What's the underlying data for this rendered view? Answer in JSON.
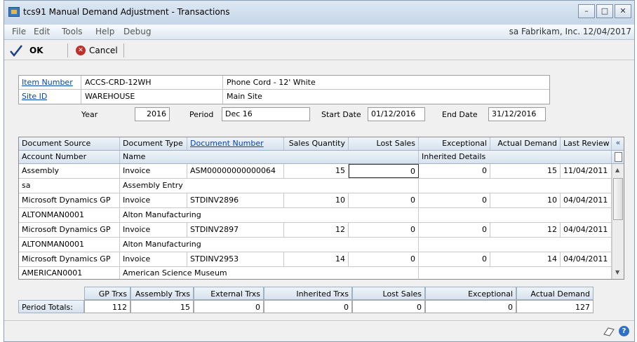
{
  "window": {
    "title": "tcs91 Manual Demand Adjustment - Transactions",
    "minimize": "–",
    "maximize": "□",
    "close": "✕"
  },
  "menu": {
    "items": [
      "File",
      "Edit",
      "Tools",
      "Help",
      "Debug"
    ],
    "company": "sa  Fabrikam, Inc. 12/04/2017"
  },
  "toolbar": {
    "ok_label": "OK",
    "cancel_label": "Cancel"
  },
  "header": {
    "item_number_label": "Item Number",
    "item_number": "ACCS-CRD-12WH",
    "item_description": "Phone Cord - 12' White",
    "site_id_label": "Site ID",
    "site_id": "WAREHOUSE",
    "site_description": "Main Site",
    "year_label": "Year",
    "year": "2016",
    "period_label": "Period",
    "period": "Dec 16",
    "start_date_label": "Start Date",
    "start_date": "01/12/2016",
    "end_date_label": "End Date",
    "end_date": "31/12/2016"
  },
  "grid": {
    "headers1": [
      "Document Source",
      "Document Type",
      "Document Number",
      "Sales Quantity",
      "Lost Sales",
      "Exceptional",
      "Actual Demand",
      "Last Review"
    ],
    "headers2": [
      "Account Number",
      "Name",
      "Inherited Details"
    ],
    "rows": [
      {
        "source": "Assembly",
        "type": "Invoice",
        "number": "ASM00000000000064",
        "sales_qty": "15",
        "lost_sales": "0",
        "exceptional": "0",
        "actual_demand": "15",
        "last_review": "11/04/2011",
        "account": "sa",
        "name": "Assembly Entry",
        "inherited": ""
      },
      {
        "source": "Microsoft Dynamics GP",
        "type": "Invoice",
        "number": "STDINV2896",
        "sales_qty": "10",
        "lost_sales": "0",
        "exceptional": "0",
        "actual_demand": "10",
        "last_review": "04/04/2011",
        "account": "ALTONMAN0001",
        "name": "Alton Manufacturing",
        "inherited": ""
      },
      {
        "source": "Microsoft Dynamics GP",
        "type": "Invoice",
        "number": "STDINV2897",
        "sales_qty": "12",
        "lost_sales": "0",
        "exceptional": "0",
        "actual_demand": "12",
        "last_review": "04/04/2011",
        "account": "ALTONMAN0001",
        "name": "Alton Manufacturing",
        "inherited": ""
      },
      {
        "source": "Microsoft Dynamics GP",
        "type": "Invoice",
        "number": "STDINV2953",
        "sales_qty": "14",
        "lost_sales": "0",
        "exceptional": "0",
        "actual_demand": "14",
        "last_review": "04/04/2011",
        "account": "AMERICAN0001",
        "name": "American Science Museum",
        "inherited": ""
      }
    ]
  },
  "totals": {
    "row_label": "Period Totals:",
    "headers": [
      "GP Trxs",
      "Assembly Trxs",
      "External Trxs",
      "Inherited Trxs",
      "Lost Sales",
      "Exceptional",
      "Actual Demand"
    ],
    "values": [
      "112",
      "15",
      "0",
      "0",
      "0",
      "0",
      "127"
    ]
  },
  "status": {
    "note_icon": "note-icon",
    "help_icon": "help-icon"
  }
}
